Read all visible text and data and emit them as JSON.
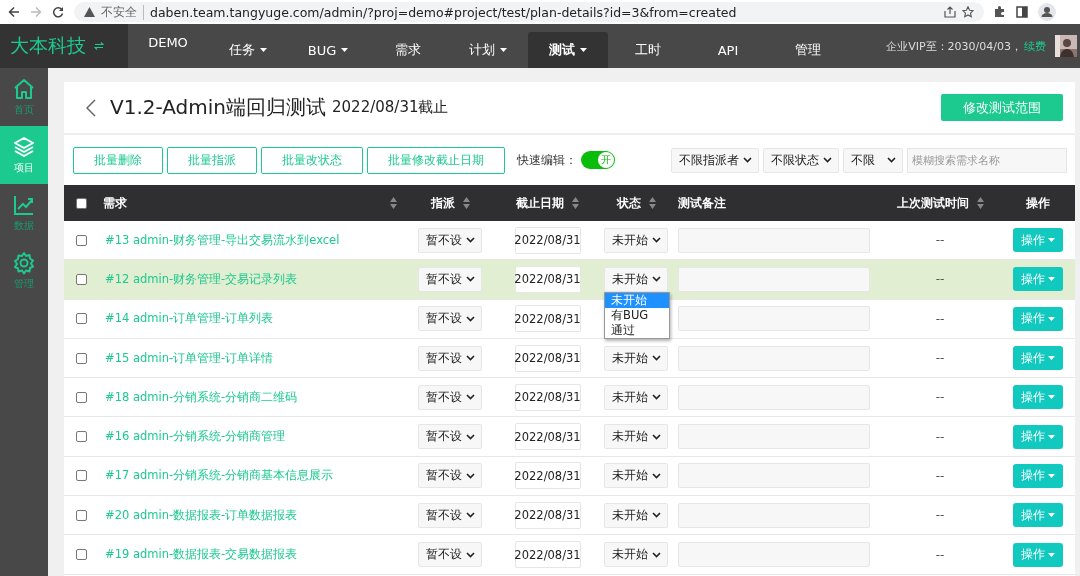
{
  "browser": {
    "security_label": "不安全",
    "url": "daben.team.tangyuge.com/admin/?proj=demo#project/test/plan-details?id=3&from=created"
  },
  "top_nav": {
    "brand": "大本科技",
    "project": "DEMO",
    "items": [
      {
        "label": "任务",
        "dropdown": true,
        "selected": false
      },
      {
        "label": "BUG",
        "dropdown": true,
        "selected": false
      },
      {
        "label": "需求",
        "dropdown": false,
        "selected": false
      },
      {
        "label": "计划",
        "dropdown": true,
        "selected": false
      },
      {
        "label": "测试",
        "dropdown": true,
        "selected": true
      },
      {
        "label": "工时",
        "dropdown": false,
        "selected": false
      },
      {
        "label": "API",
        "dropdown": false,
        "selected": false
      },
      {
        "label": "管理",
        "dropdown": false,
        "selected": false
      }
    ],
    "vip_text": "企业VIP至：2030/04/03，",
    "renew_link": "续费"
  },
  "sidebar": {
    "items": [
      {
        "label": "首页",
        "kind": "home",
        "selected": false
      },
      {
        "label": "项目",
        "kind": "layers",
        "selected": true
      },
      {
        "label": "数据",
        "kind": "chart",
        "selected": false
      },
      {
        "label": "管理",
        "kind": "gear",
        "selected": false
      }
    ]
  },
  "header": {
    "title": "V1.2-Admin端回归测试",
    "deadline": "2022/08/31截止",
    "action_button": "修改测试范围"
  },
  "toolbar": {
    "buttons": [
      "批量删除",
      "批量指派",
      "批量改状态",
      "批量修改截止日期"
    ],
    "quick_edit": {
      "label": "快速编辑：",
      "on": true,
      "toggle_text": "开"
    },
    "filters": [
      "不限指派者",
      "不限状态",
      "不限"
    ],
    "search": {
      "placeholder": "模糊搜索需求名称"
    }
  },
  "table": {
    "select_all_checked": false,
    "columns": [
      {
        "label": "需求",
        "sortable": true
      },
      {
        "label": "指派",
        "sortable": true
      },
      {
        "label": "截止日期",
        "sortable": true
      },
      {
        "label": "状态",
        "sortable": true
      },
      {
        "label": "测试备注",
        "sortable": false
      },
      {
        "label": "上次测试时间",
        "sortable": true
      },
      {
        "label": "操作",
        "sortable": false
      }
    ],
    "rows": [
      {
        "checked": false,
        "highlighted": false,
        "requirement": "#13 admin-财务管理-导出交易流水到excel",
        "assignee": "暂不设",
        "deadline": "2022/08/31",
        "status": {
          "value": "未开始",
          "open": false
        },
        "last_test": "--",
        "action": "操作"
      },
      {
        "checked": false,
        "highlighted": true,
        "requirement": "#12 admin-财务管理-交易记录列表",
        "assignee": "暂不设",
        "deadline": "2022/08/31",
        "status": {
          "value": "未开始",
          "open": true,
          "options": [
            {
              "label": "未开始",
              "selected": true
            },
            {
              "label": "有BUG",
              "selected": false
            },
            {
              "label": "通过",
              "selected": false
            }
          ]
        },
        "last_test": "--",
        "action": "操作"
      },
      {
        "checked": false,
        "highlighted": false,
        "requirement": "#14 admin-订单管理-订单列表",
        "assignee": "暂不设",
        "deadline": "2022/08/31",
        "last_test": "--",
        "action": "操作"
      },
      {
        "checked": false,
        "highlighted": false,
        "requirement": "#15 admin-订单管理-订单详情",
        "assignee": "暂不设",
        "deadline": "2022/08/31",
        "status": {
          "value": "未开始",
          "open": false
        },
        "last_test": "--",
        "action": "操作"
      },
      {
        "checked": false,
        "highlighted": false,
        "requirement": "#18 admin-分销系统-分销商二维码",
        "assignee": "暂不设",
        "deadline": "2022/08/31",
        "status": {
          "value": "未开始",
          "open": false
        },
        "last_test": "--",
        "action": "操作"
      },
      {
        "checked": false,
        "highlighted": false,
        "requirement": "#16 admin-分销系统-分销商管理",
        "assignee": "暂不设",
        "deadline": "2022/08/31",
        "status": {
          "value": "未开始",
          "open": false
        },
        "last_test": "--",
        "action": "操作"
      },
      {
        "checked": false,
        "highlighted": false,
        "requirement": "#17 admin-分销系统-分销商基本信息展示",
        "assignee": "暂不设",
        "deadline": "2022/08/31",
        "status": {
          "value": "未开始",
          "open": false
        },
        "last_test": "--",
        "action": "操作"
      },
      {
        "checked": false,
        "highlighted": false,
        "requirement": "#20 admin-数据报表-订单数据报表",
        "assignee": "暂不设",
        "deadline": "2022/08/31",
        "status": {
          "value": "未开始",
          "open": false
        },
        "last_test": "--",
        "action": "操作"
      },
      {
        "checked": false,
        "highlighted": false,
        "requirement": "#19 admin-数据报表-交易数据报表",
        "assignee": "暂不设",
        "deadline": "2022/08/31",
        "status": {
          "value": "未开始",
          "open": false
        },
        "last_test": "--",
        "action": "操作"
      }
    ]
  }
}
